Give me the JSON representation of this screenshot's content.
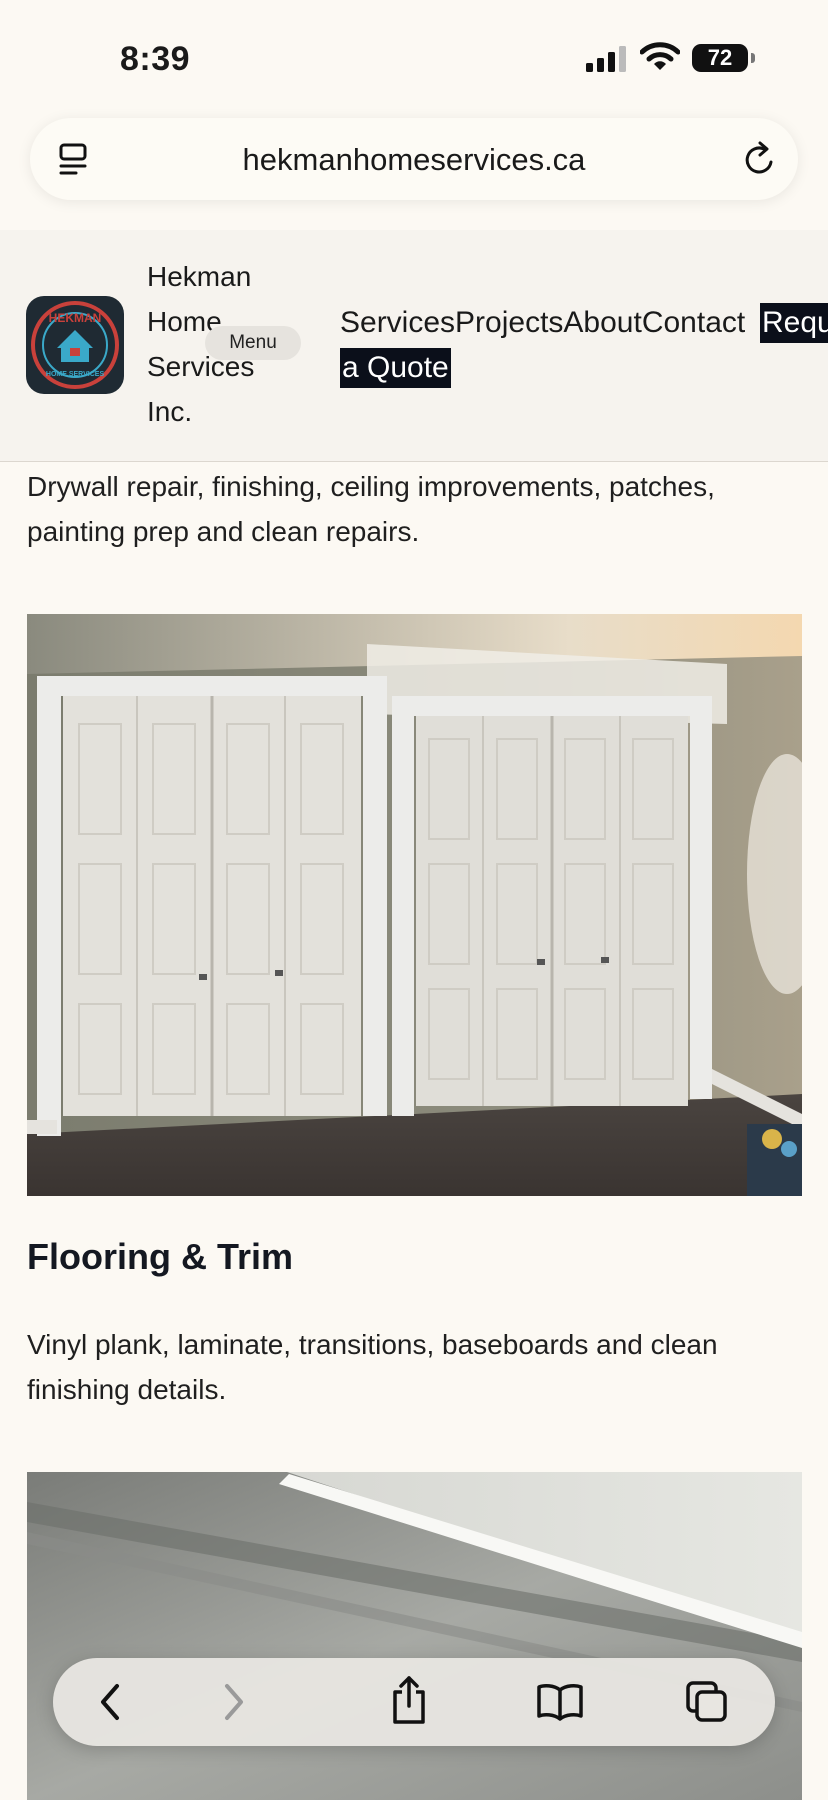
{
  "status": {
    "time": "8:39",
    "battery": "72"
  },
  "browser": {
    "url": "hekmanhomeservices.ca"
  },
  "header": {
    "brand_lines": [
      "Hekman",
      "Home",
      "Services",
      "Inc."
    ],
    "menu_label": "Menu",
    "nav": [
      "Services",
      "Projects",
      "About",
      "Contact"
    ],
    "cta_part1": "Requ",
    "cta_part2": "a Quote",
    "logo_text_top": "HEKMAN",
    "logo_text_bottom": "HOME SERVICES"
  },
  "sections": {
    "drywall_desc": "Drywall repair, finishing, ceiling improvements, patches, painting prep and clean repairs.",
    "flooring_title": "Flooring & Trim",
    "flooring_desc": "Vinyl plank, laminate, transitions, baseboards and clean finishing details."
  },
  "toolbar_icons": [
    "back-icon",
    "forward-icon",
    "share-icon",
    "bookmarks-icon",
    "tabs-icon"
  ]
}
